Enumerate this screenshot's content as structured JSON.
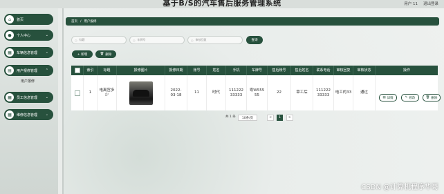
{
  "app": {
    "title": "基于B/S的汽车售后服务管理系统",
    "user": "用户 11",
    "logout": "退出登录"
  },
  "sidebar": {
    "items": [
      {
        "label": "首页",
        "icon": "home-icon"
      },
      {
        "label": "个人中心",
        "icon": "person-icon"
      },
      {
        "label": "车辆信息管理",
        "icon": "grid-icon"
      },
      {
        "label": "用户报修管理",
        "icon": "list-icon"
      },
      {
        "label": "员工信息管理",
        "icon": "grid-icon"
      },
      {
        "label": "维修信息管理",
        "icon": "grid-icon"
      }
    ],
    "subitem": "用户报修"
  },
  "breadcrumb": {
    "home": "首页",
    "sep": "/",
    "current": "用户报修"
  },
  "search": {
    "p1": "标题",
    "p2": "车牌号",
    "p3": "审核回复",
    "button": "查询"
  },
  "actions": {
    "add": "+ 新增",
    "delete": "删除"
  },
  "table": {
    "headers": [
      "",
      "索引",
      "标题",
      "报修图片",
      "报修日期",
      "账号",
      "姓名",
      "手机",
      "车牌号",
      "售后账号",
      "售后姓名",
      "联系电话",
      "审核回复",
      "审核状态",
      "操作"
    ],
    "row": {
      "index": "1",
      "title": "电离宫多少",
      "date": "2022-03-18",
      "account": "11",
      "name": "时代",
      "phone": "11122233333",
      "plate": "粤W55555",
      "after_account": "22",
      "after_name": "章工后",
      "contact": "11122233333",
      "reply": "电工的33",
      "status": "通过",
      "btn_detail": "详情",
      "btn_edit": "修改",
      "btn_delete": "删除"
    }
  },
  "pagination": {
    "total": "共 1 条",
    "size": "10条/页",
    "prev": "<",
    "page": "1",
    "next": ">"
  },
  "watermark": "CSDN @计算机程序华哥",
  "colors": {
    "primary": "#27513d"
  }
}
